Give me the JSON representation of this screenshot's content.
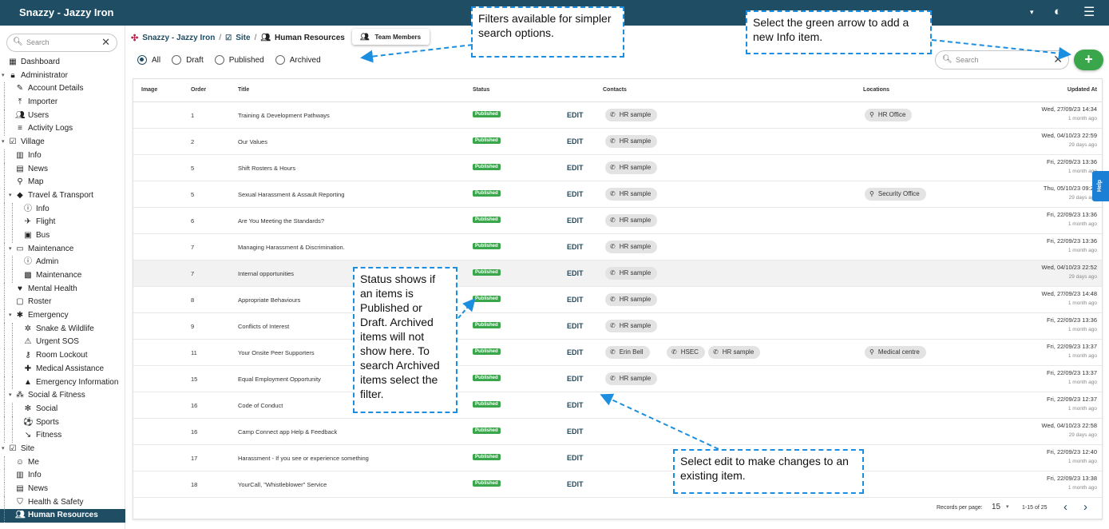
{
  "app": {
    "title": "Snazzy - Jazzy Iron"
  },
  "sidebar": {
    "search_placeholder": "Search",
    "items": [
      {
        "label": "Dashboard",
        "icon": "dashboard-icon",
        "level": 0,
        "caret": false
      },
      {
        "label": "Administrator",
        "icon": "lock-icon",
        "level": 0,
        "caret": true
      },
      {
        "label": "Account Details",
        "icon": "pencil-icon",
        "level": 1,
        "caret": false
      },
      {
        "label": "Importer",
        "icon": "upload-icon",
        "level": 1,
        "caret": false
      },
      {
        "label": "Users",
        "icon": "users-icon",
        "level": 1,
        "caret": false
      },
      {
        "label": "Activity Logs",
        "icon": "list-icon",
        "level": 1,
        "caret": false
      },
      {
        "label": "Village",
        "icon": "checklist-icon",
        "level": 0,
        "caret": true
      },
      {
        "label": "Info",
        "icon": "building-icon",
        "level": 1,
        "caret": false
      },
      {
        "label": "News",
        "icon": "newspaper-icon",
        "level": 1,
        "caret": false
      },
      {
        "label": "Map",
        "icon": "pin-icon",
        "level": 1,
        "caret": false
      },
      {
        "label": "Travel & Transport",
        "icon": "direction-icon",
        "level": 1,
        "caret": true
      },
      {
        "label": "Info",
        "icon": "info-icon",
        "level": 2,
        "caret": false
      },
      {
        "label": "Flight",
        "icon": "plane-icon",
        "level": 2,
        "caret": false
      },
      {
        "label": "Bus",
        "icon": "bus-icon",
        "level": 2,
        "caret": false
      },
      {
        "label": "Maintenance",
        "icon": "laptop-icon",
        "level": 1,
        "caret": true
      },
      {
        "label": "Admin",
        "icon": "info-icon",
        "level": 2,
        "caret": false
      },
      {
        "label": "Maintenance",
        "icon": "toolbox-icon",
        "level": 2,
        "caret": false
      },
      {
        "label": "Mental Health",
        "icon": "hands-heart-icon",
        "level": 1,
        "caret": false
      },
      {
        "label": "Roster",
        "icon": "calendar-icon",
        "level": 1,
        "caret": false
      },
      {
        "label": "Emergency",
        "icon": "asterisk-icon",
        "level": 1,
        "caret": true
      },
      {
        "label": "Snake & Wildlife",
        "icon": "bug-icon",
        "level": 2,
        "caret": false
      },
      {
        "label": "Urgent SOS",
        "icon": "alarm-icon",
        "level": 2,
        "caret": false
      },
      {
        "label": "Room Lockout",
        "icon": "key-icon",
        "level": 2,
        "caret": false
      },
      {
        "label": "Medical Assistance",
        "icon": "medkit-icon",
        "level": 2,
        "caret": false
      },
      {
        "label": "Emergency Information",
        "icon": "warning-icon",
        "level": 2,
        "caret": false
      },
      {
        "label": "Social & Fitness",
        "icon": "group-icon",
        "level": 1,
        "caret": true
      },
      {
        "label": "Social",
        "icon": "people-icon",
        "level": 2,
        "caret": false
      },
      {
        "label": "Sports",
        "icon": "ball-icon",
        "level": 2,
        "caret": false
      },
      {
        "label": "Fitness",
        "icon": "run-icon",
        "level": 2,
        "caret": false
      },
      {
        "label": "Site",
        "icon": "checklist-icon",
        "level": 0,
        "caret": true
      },
      {
        "label": "Me",
        "icon": "face-icon",
        "level": 1,
        "caret": false
      },
      {
        "label": "Info",
        "icon": "building-icon",
        "level": 1,
        "caret": false
      },
      {
        "label": "News",
        "icon": "newspaper-icon",
        "level": 1,
        "caret": false
      },
      {
        "label": "Health & Safety",
        "icon": "shield-icon",
        "level": 1,
        "caret": false
      },
      {
        "label": "Human Resources",
        "icon": "users-icon",
        "level": 1,
        "caret": false,
        "active": true
      }
    ]
  },
  "breadcrumb": {
    "root": "Snazzy - Jazzy Iron",
    "site": "Site",
    "current": "Human Resources",
    "team_button": "Team Members"
  },
  "filters": {
    "options": [
      "All",
      "Draft",
      "Published",
      "Archived"
    ],
    "selected": "All"
  },
  "search": {
    "placeholder": "Search"
  },
  "table": {
    "columns": {
      "image": "Image",
      "order": "Order",
      "title": "Title",
      "status": "Status",
      "contacts": "Contacts",
      "locations": "Locations",
      "updated": "Updated At"
    },
    "edit_label": "EDIT",
    "rows": [
      {
        "order": "1",
        "title": "Training & Development Pathways",
        "status": "Published",
        "contacts": [
          "HR sample"
        ],
        "locations": [
          "HR Office"
        ],
        "updated": "Wed, 27/09/23 14:34",
        "ago": "1 month ago"
      },
      {
        "order": "2",
        "title": "Our Values",
        "status": "Published",
        "contacts": [
          "HR sample"
        ],
        "locations": [],
        "updated": "Wed, 04/10/23 22:59",
        "ago": "29 days ago"
      },
      {
        "order": "5",
        "title": "Shift Rosters & Hours",
        "status": "Published",
        "contacts": [
          "HR sample"
        ],
        "locations": [],
        "updated": "Fri, 22/09/23 13:36",
        "ago": "1 month ago"
      },
      {
        "order": "5",
        "title": "Sexual Harassment & Assault Reporting",
        "status": "Published",
        "contacts": [
          "HR sample"
        ],
        "locations": [
          "Security Office"
        ],
        "updated": "Thu, 05/10/23 09:27",
        "ago": "29 days ago"
      },
      {
        "order": "6",
        "title": "Are You Meeting the Standards?",
        "status": "Published",
        "contacts": [
          "HR sample"
        ],
        "locations": [],
        "updated": "Fri, 22/09/23 13:36",
        "ago": "1 month ago"
      },
      {
        "order": "7",
        "title": "Managing Harassment & Discrimination.",
        "status": "Published",
        "contacts": [
          "HR sample"
        ],
        "locations": [],
        "updated": "Fri, 22/09/23 13:36",
        "ago": "1 month ago"
      },
      {
        "order": "7",
        "title": "Internal opportunities",
        "status": "Published",
        "contacts": [
          "HR sample"
        ],
        "locations": [],
        "updated": "Wed, 04/10/23 22:52",
        "ago": "29 days ago"
      },
      {
        "order": "8",
        "title": "Appropriate Behaviours",
        "status": "Published",
        "contacts": [
          "HR sample"
        ],
        "locations": [],
        "updated": "Wed, 27/09/23 14:48",
        "ago": "1 month ago"
      },
      {
        "order": "9",
        "title": "Conflicts of Interest",
        "status": "Published",
        "contacts": [
          "HR sample"
        ],
        "locations": [],
        "updated": "Fri, 22/09/23 13:36",
        "ago": "1 month ago"
      },
      {
        "order": "11",
        "title": "Your Onsite Peer Supporters",
        "status": "Published",
        "contacts": [
          "Erin Bell",
          "HSEC",
          "HR sample"
        ],
        "locations": [
          "Medical centre"
        ],
        "updated": "Fri, 22/09/23 13:37",
        "ago": "1 month ago"
      },
      {
        "order": "15",
        "title": "Equal Employment Opportunity",
        "status": "Published",
        "contacts": [
          "HR sample"
        ],
        "locations": [],
        "updated": "Fri, 22/09/23 13:37",
        "ago": "1 month ago"
      },
      {
        "order": "16",
        "title": "Code of Conduct",
        "status": "Published",
        "contacts": [],
        "locations": [],
        "updated": "Fri, 22/09/23 12:37",
        "ago": "1 month ago"
      },
      {
        "order": "16",
        "title": "Camp Connect app Help & Feedback",
        "status": "Published",
        "contacts": [],
        "locations": [],
        "updated": "Wed, 04/10/23 22:58",
        "ago": "29 days ago"
      },
      {
        "order": "17",
        "title": "Harassment - If you see or experience something",
        "status": "Published",
        "contacts": [],
        "locations": [],
        "updated": "Fri, 22/09/23 12:40",
        "ago": "1 month ago"
      },
      {
        "order": "18",
        "title": "YourCall, \"Whistleblower\" Service",
        "status": "Published",
        "contacts": [],
        "locations": [],
        "updated": "Fri, 22/09/23 13:38",
        "ago": "1 month ago"
      }
    ],
    "pagination": {
      "label": "Records per page:",
      "per_page": "15",
      "range": "1-15 of 25"
    }
  },
  "help_tab": "Help",
  "callouts": {
    "filters": "Filters available for simpler search options.",
    "add": "Select the green arrow to add a new Info item.",
    "status": "Status shows if an items is Published or Draft. Archived items will not show here. To search Archived items select the filter.",
    "edit": "Select edit to make changes to an existing  item."
  },
  "colors": {
    "topbar": "#1f4d63",
    "accent": "#1f4d63",
    "published": "#3aa64b",
    "add_button": "#3aa64b",
    "callout_border": "#1b8ee0",
    "help": "#1b7fd6"
  }
}
